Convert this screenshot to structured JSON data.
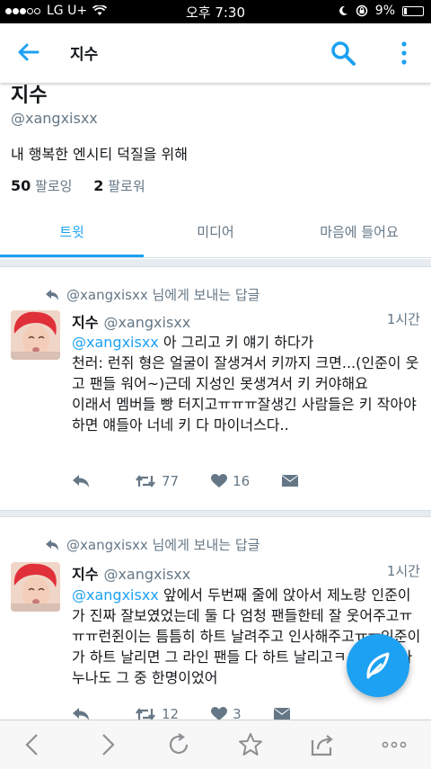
{
  "status_bar": {
    "carrier": "LG U+",
    "time": "오후 7:30",
    "battery": "9%"
  },
  "app_bar": {
    "title": "지수"
  },
  "profile": {
    "name": "지수",
    "handle": "@xangxisxx",
    "bio": "내 행복한 엔시티 덕질을 위해",
    "following_count": "50",
    "following_label": "팔로잉",
    "followers_count": "2",
    "followers_label": "팔로워"
  },
  "tabs": [
    {
      "label": "트윗",
      "active": true
    },
    {
      "label": "미디어",
      "active": false
    },
    {
      "label": "마음에 들어요",
      "active": false
    }
  ],
  "tweets": [
    {
      "reply_to": "@xangxisxx 님에게 보내는 답글",
      "name": "지수",
      "handle": "@xangxisxx",
      "time": "1시간",
      "mention": "@xangxisxx",
      "text": " 아 그리고 키 얘기 하다가\n천러: 런쥐 형은 얼굴이 잘생겨서 키까지 크면...(인준이 웃고 팬들 워어~)근데 지성인 못생겨서 키 커야해요\n이래서 멤버들 빵 터지고ㅠㅠㅠ잘생긴 사람들은 키 작아야 하면 얘들아 너네 키 다 마이너스다..",
      "retweets": "77",
      "likes": "16"
    },
    {
      "reply_to": "@xangxisxx 님에게 보내는 답글",
      "name": "지수",
      "handle": "@xangxisxx",
      "time": "1시간",
      "mention": "@xangxisxx",
      "text": " 앞에서 두번째 줄에 앉아서 제노랑 인준이가 진짜 잘보였었는데 둘 다 엄청 팬들한테 잘 웃어주고ㅠㅠㅠ런쥔이는 틈틈히 하트 날려주고 인사해주고ㅠㅠ인준이가 하트 날리면 그 라인 팬들 다 하트 날리고ㅋㅋㅋ인준아 누나도 그 중 한명이었어",
      "retweets": "12",
      "likes": "3"
    }
  ],
  "colors": {
    "accent": "#1da1f2",
    "text": "#14171a",
    "muted": "#657786"
  }
}
